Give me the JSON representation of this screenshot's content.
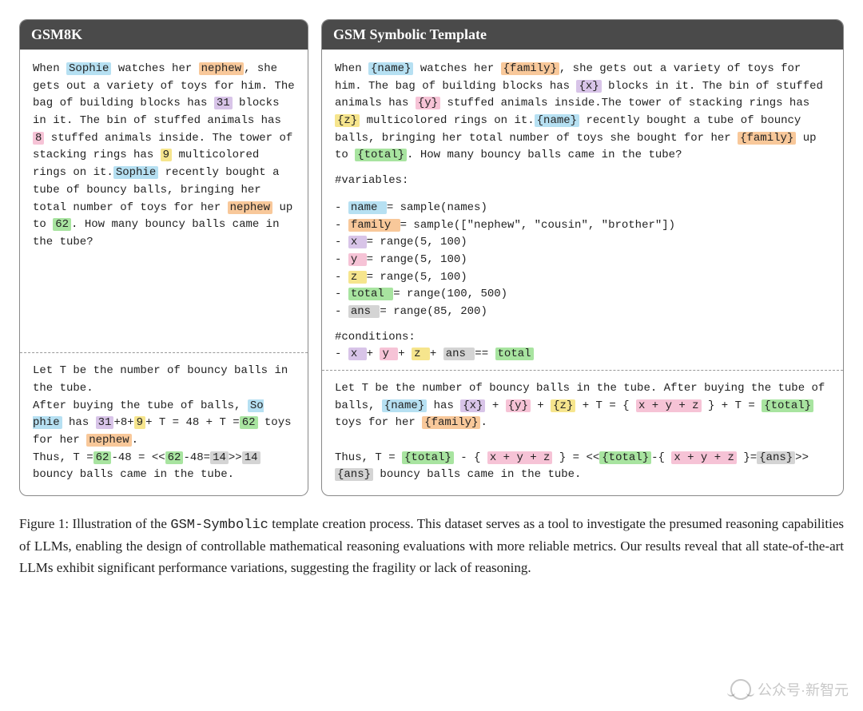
{
  "left": {
    "title": "GSM8K",
    "body": {
      "t1": "When ",
      "name1": "Sophie",
      "t2": " watches her ",
      "family1": "nephew",
      "t3": ", she gets out a variety of toys for him. The bag of building blocks has ",
      "x": "31",
      "t4": " blocks in it.  The bin of stuffed animals has ",
      "y": "8",
      "t5": " stuffed animals inside. The tower of stacking rings has ",
      "z": "9",
      "t6": " multicolored rings on it.",
      "name2": "Sophie",
      "t7": " recently bought a tube of bouncy balls, bringing her total number of toys for her ",
      "family2": "nephew",
      "t8": " up to ",
      "total": "62",
      "t9": ".  How many bouncy balls came in the tube?"
    },
    "sol": {
      "s1": "Let T be the number of bouncy balls in the tube.",
      "s2a": "After buying the tube of balls, ",
      "name": "So phie",
      "s2b": " has ",
      "x": "31",
      "mid1": "+8+",
      "z": "9",
      "mid2": "+ T = 48 + T =",
      "total": "62",
      "s2c": " toys for her ",
      "family": "nephew",
      "s2d": ".",
      "s3a": "Thus, T =",
      "total2": "62",
      "s3b": "-48 = <<",
      "total3": "62",
      "s3c": "-48=",
      "ans1": "14",
      "s3d": ">>",
      "ans2": "14",
      "s3e": " bouncy balls came in the tube."
    }
  },
  "right": {
    "title": "GSM Symbolic Template",
    "body": {
      "t1": "When ",
      "name1": "{name}",
      "t2": " watches her ",
      "family1": "{family}",
      "t3": ", she gets out a variety of toys for him.  The bag of building blocks has ",
      "x": "{x}",
      "t4": " blocks in it.  The bin of stuffed animals has ",
      "y": "{y}",
      "t5": " stuffed animals inside.The tower of stacking rings has ",
      "z": "{z}",
      "t6": " multicolored rings on it.",
      "name2": "{name}",
      "t7": " recently bought a tube of bouncy balls, bringing her total number of toys she bought for her ",
      "family2": "{family}",
      "t8": " up to ",
      "total": "{total}",
      "t9": ".  How many bouncy balls came in the tube?"
    },
    "vars_head": "#variables:",
    "vars": [
      {
        "dash": "- ",
        "var": " name ",
        "cls": "blue",
        "rhs": " = sample(names)"
      },
      {
        "dash": "- ",
        "var": " family ",
        "cls": "orange",
        "rhs": " = sample([\"nephew\", \"cousin\", \"brother\"])"
      },
      {
        "dash": "- ",
        "var": " x ",
        "cls": "purple",
        "rhs": " = range(5, 100)"
      },
      {
        "dash": "- ",
        "var": " y ",
        "cls": "pink",
        "rhs": " = range(5, 100)"
      },
      {
        "dash": "- ",
        "var": " z ",
        "cls": "yellow",
        "rhs": " = range(5, 100)"
      },
      {
        "dash": "- ",
        "var": " total ",
        "cls": "green",
        "rhs": "  = range(100, 500)"
      },
      {
        "dash": "- ",
        "var": " ans ",
        "cls": "grey",
        "rhs": "  = range(85, 200)"
      }
    ],
    "cond_head": "#conditions:",
    "cond": {
      "dash": "- ",
      "x": " x ",
      "plus1": " + ",
      "y": " y ",
      "plus2": " + ",
      "z": " z ",
      "plus3": " + ",
      "ans": " ans ",
      "eq": " ==  ",
      "total": " total "
    },
    "sol": {
      "s1": "Let T be the number of bouncy balls in the tube.  After buying the tube of balls, ",
      "name": "{name}",
      "s1b": " has ",
      "x": "{x}",
      "plus1": " + ",
      "y": "{y}",
      "plus2": " + ",
      "z": "{z}",
      "s1c": " + T = { ",
      "expr1": "x + y + z",
      "s1d": " } + T = ",
      "total1": "{total}",
      "s1e": " toys for her ",
      "family": "{family}",
      "s1f": ".",
      "s2a": "Thus, T = ",
      "total2": "{total}",
      "s2b": " - { ",
      "expr2": "x + y + z",
      "s2c": " } = <<",
      "total3": "{total}",
      "s2d": "-{ ",
      "expr3": "x + y + z",
      "s2e": " }=",
      "ans1": "{ans}",
      "s2f": ">>",
      "ans2": "{ans}",
      "s2g": " bouncy balls came in the tube."
    }
  },
  "caption": {
    "lead": "Figure 1: Illustration of the ",
    "mono": "GSM-Symbolic",
    "rest": " template creation process. This dataset serves as a tool to investigate the presumed reasoning capabilities of LLMs, enabling the design of controllable mathematical reasoning evaluations with more reliable metrics. Our results reveal that all state-of-the-art LLMs exhibit significant performance variations, suggesting the fragility or lack of reasoning."
  },
  "watermark": "公众号·新智元"
}
